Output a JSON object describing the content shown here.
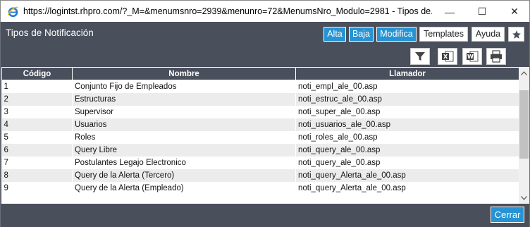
{
  "window": {
    "title": "https://logintst.rhpro.com/?_M=&menumsnro=2939&menunro=72&MenumsNro_Modulo=2981 - Tipos de...",
    "minimize_glyph": "—",
    "maximize_glyph": "☐",
    "close_glyph": "✕"
  },
  "page": {
    "title": "Tipos de Notificación"
  },
  "toolbar": {
    "alta": "Alta",
    "baja": "Baja",
    "modifica": "Modifica",
    "templates": "Templates",
    "ayuda": "Ayuda",
    "favorite_icon": "star-icon"
  },
  "tools": {
    "filter_icon": "filter-icon",
    "excel_icon": "excel-export-icon",
    "word_icon": "word-export-icon",
    "print_icon": "print-icon"
  },
  "grid": {
    "headers": [
      "Código",
      "Nombre",
      "Llamador"
    ],
    "rows": [
      [
        "1",
        "Conjunto Fijo de Empleados",
        "noti_empl_ale_00.asp"
      ],
      [
        "2",
        "Estructuras",
        "noti_estruc_ale_00.asp"
      ],
      [
        "3",
        "Supervisor",
        "noti_super_ale_00.asp"
      ],
      [
        "4",
        "Usuarios",
        "noti_usuarios_ale_00.asp"
      ],
      [
        "5",
        "Roles",
        "noti_roles_ale_00.asp"
      ],
      [
        "6",
        "Query Libre",
        "noti_query_ale_00.asp"
      ],
      [
        "7",
        "Postulantes Legajo Electronico",
        "noti_query_ale_00.asp"
      ],
      [
        "8",
        "Query de la Alerta (Tercero)",
        "noti_query_Alerta_ale_00.asp"
      ],
      [
        "9",
        "Query de la Alerta (Empleado)",
        "noti_query_Alerta_ale_00.asp"
      ]
    ]
  },
  "footer": {
    "cerrar": "Cerrar"
  },
  "colors": {
    "header_bg": "#4a4f5c",
    "accent_blue": "#2693d4",
    "row_alt": "#ececec"
  }
}
